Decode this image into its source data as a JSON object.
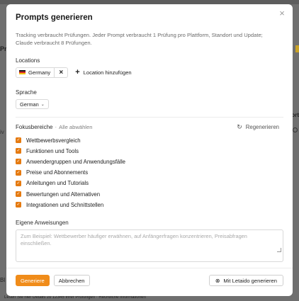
{
  "background": {
    "left_frag_top": "Pr",
    "left_frag_mid": "iv",
    "left_frag_bottom": "Bl",
    "right_frag": "ort",
    "bottom_text": "Lesen Sie hier Details zu 12345 Ihrer Prüfungen · Rechtliche Informationen"
  },
  "modal": {
    "title": "Prompts generieren",
    "close_icon": "×",
    "description": "Tracking verbraucht Prüfungen. Jeder Prompt verbraucht 1 Prüfung pro Plattform, Standort und Update; Claude verbraucht 8 Prüfungen.",
    "locations": {
      "label": "Locations",
      "selected": [
        {
          "name": "Germany",
          "flag": "flag-de-icon"
        }
      ],
      "remove_icon": "×",
      "add_label": "Location hinzufügen",
      "add_icon": "+"
    },
    "language": {
      "label": "Sprache",
      "selected": "German",
      "chevron": "⌄"
    },
    "focus": {
      "label": "Fokusbereiche",
      "separator": "·",
      "deselect_all": "Alle abwählen",
      "regenerate": "Regenerieren",
      "regenerate_icon": "↻",
      "items": [
        {
          "label": "Wettbewerbsvergleich",
          "checked": true
        },
        {
          "label": "Funktionen und Tools",
          "checked": true
        },
        {
          "label": "Anwendergruppen und Anwendungsfälle",
          "checked": true
        },
        {
          "label": "Preise und Abonnements",
          "checked": true
        },
        {
          "label": "Anleitungen und Tutorials",
          "checked": true
        },
        {
          "label": "Bewertungen und Alternativen",
          "checked": true
        },
        {
          "label": "Integrationen und Schnittstellen",
          "checked": true
        }
      ],
      "check_glyph": "✓"
    },
    "instructions": {
      "label": "Eigene Anweisungen",
      "value": "",
      "placeholder": "Zum Beispiel: Wettbewerber häufiger erwähnen, auf Anfängerfragen konzentrieren, Preisabfragen einschließen."
    },
    "footer": {
      "generate": "Generiere",
      "cancel": "Abbrechen",
      "ai_generate": "Mit Letaido generieren",
      "ai_icon": "⊗"
    }
  },
  "colors": {
    "accent": "#f08c1a",
    "checkbox": "#e57a10",
    "overlay": "#6f6f6f"
  }
}
